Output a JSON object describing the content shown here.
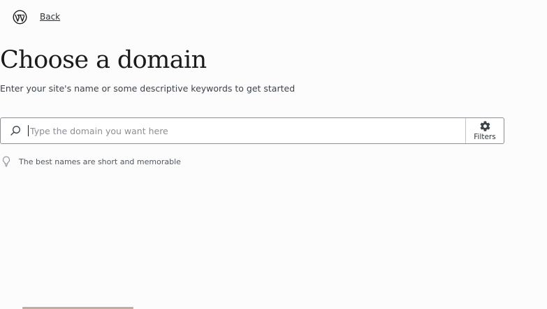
{
  "header": {
    "logo_icon": "wordpress-logo-icon",
    "back_label": "Back"
  },
  "main": {
    "title": "Choose a domain",
    "subtitle": "Enter your site's name or some descriptive keywords to get started"
  },
  "search": {
    "icon": "search-icon",
    "placeholder": "Type the domain you want here",
    "value": "",
    "filters_icon": "gear-icon",
    "filters_label": "Filters"
  },
  "hint": {
    "icon": "lightbulb-icon",
    "text": "The best names are short and memorable"
  },
  "colors": {
    "background": "#fdfcfc",
    "text": "#1e1e1e",
    "border": "#8c8f94",
    "progress_accent": "#c2ada3"
  }
}
